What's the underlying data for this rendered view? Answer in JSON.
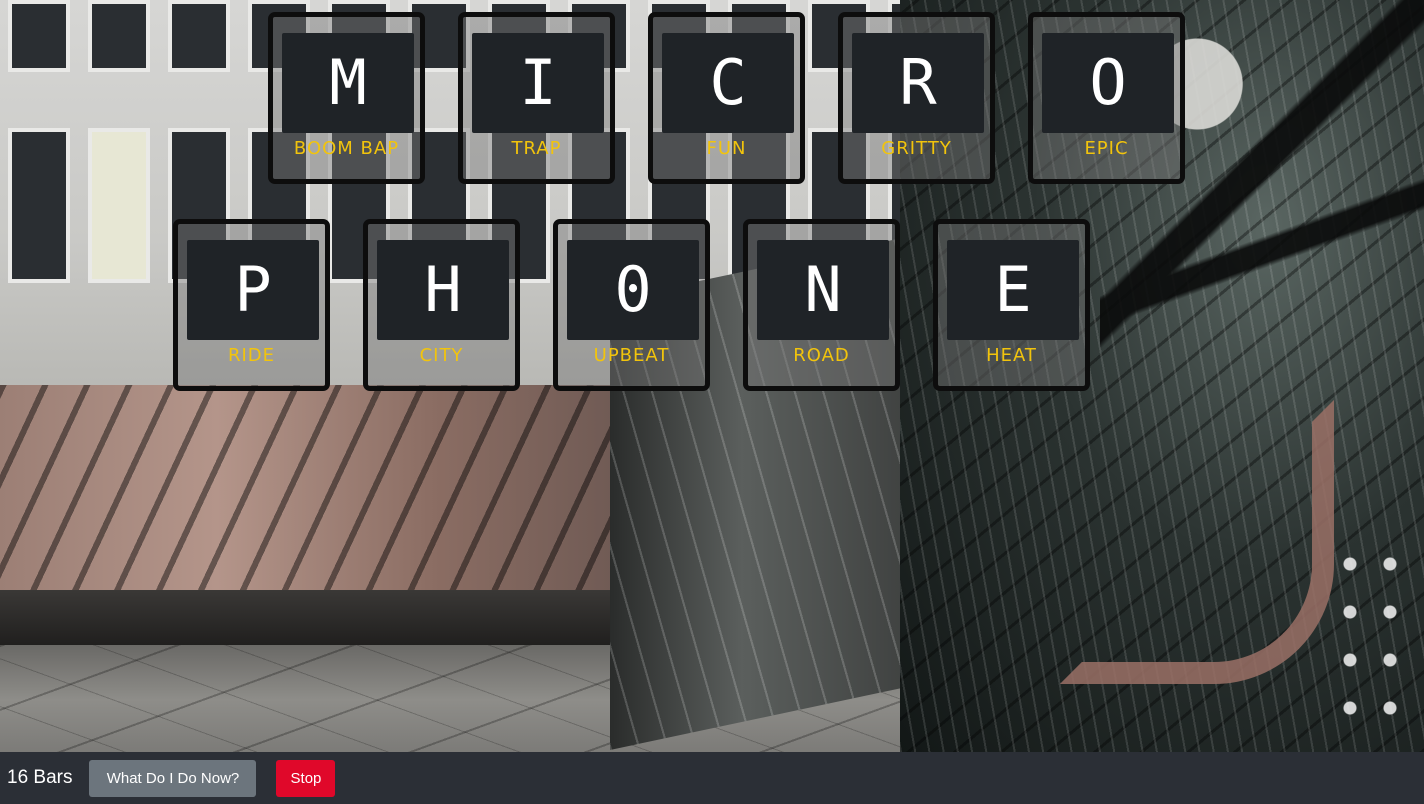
{
  "tiles": [
    {
      "letter": "M",
      "label": "BOOM BAP"
    },
    {
      "letter": "I",
      "label": "TRAP"
    },
    {
      "letter": "C",
      "label": "FUN"
    },
    {
      "letter": "R",
      "label": "GRITTY"
    },
    {
      "letter": "O",
      "label": "EPIC"
    },
    {
      "letter": "P",
      "label": "RIDE"
    },
    {
      "letter": "H",
      "label": "CITY"
    },
    {
      "letter": "0",
      "label": "UPBEAT"
    },
    {
      "letter": "N",
      "label": "ROAD"
    },
    {
      "letter": "E",
      "label": "HEAT"
    }
  ],
  "bottom_bar": {
    "title": "16 Bars",
    "help_button": "What Do I Do Now?",
    "stop_button": "Stop"
  },
  "colors": {
    "tile_label": "#f2c40c",
    "tile_face": "#1f2327",
    "bar_background": "#2b2f36",
    "help_button": "#6c757d",
    "stop_button": "#e0082a"
  }
}
